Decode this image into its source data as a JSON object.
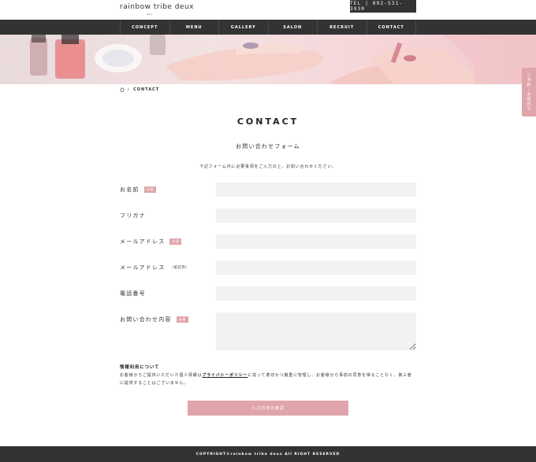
{
  "header": {
    "logo": "rainbow tribe deux",
    "logo_sub": "nail",
    "tel": "TEL | 092-531-3930"
  },
  "nav": {
    "items": [
      "CONCEPT",
      "MENU",
      "GALLERY",
      "SALON",
      "RECRUIT",
      "CONTACT"
    ]
  },
  "side_tab": {
    "label": "ご予約・お問合せ"
  },
  "breadcrumb": {
    "current": "CONTACT"
  },
  "page": {
    "title": "CONTACT",
    "form_title": "お問い合わせフォーム",
    "intro": "下記フォーム内に必要事項をご入力の上、お問い合わせください。"
  },
  "form": {
    "required_badge": "必須",
    "fields": [
      {
        "label": "お名前",
        "required": true
      },
      {
        "label": "フリガナ",
        "required": false
      },
      {
        "label": "メールアドレス",
        "required": true
      },
      {
        "label": "メールアドレス",
        "note": "（確認用）",
        "required": false
      },
      {
        "label": "電話番号",
        "required": false
      },
      {
        "label": "お問い合わせ内容",
        "required": true
      }
    ]
  },
  "privacy": {
    "title": "情報利用について",
    "text_before": "お客様からご提供いただいた個人情報は",
    "link": "プライバシーポリシー",
    "text_after": "に従って適切かつ厳重に管理し、お客様から事前の同意を得ることなく、第三者に提供することはございません。"
  },
  "submit": {
    "label": "入力内容の確認"
  },
  "footer": {
    "copyright": "COPYRIGHT©rainbow tribe deux All RIGHT RESERVED"
  },
  "colors": {
    "dark": "#333333",
    "accent_pink": "#e0a5ab",
    "input_bg": "#f2f2f2"
  }
}
